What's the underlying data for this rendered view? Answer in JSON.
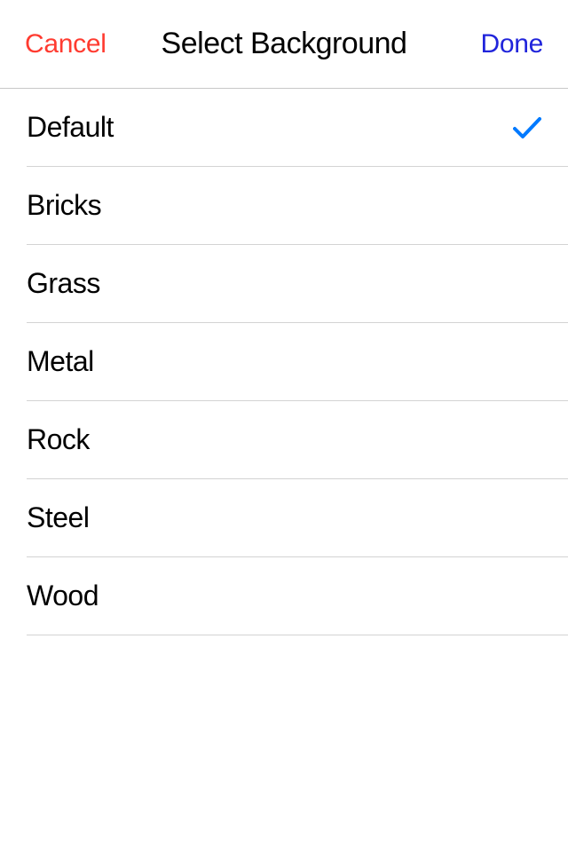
{
  "navbar": {
    "cancel_label": "Cancel",
    "title": "Select Background",
    "done_label": "Done"
  },
  "list": {
    "items": [
      {
        "label": "Default",
        "selected": true
      },
      {
        "label": "Bricks",
        "selected": false
      },
      {
        "label": "Grass",
        "selected": false
      },
      {
        "label": "Metal",
        "selected": false
      },
      {
        "label": "Rock",
        "selected": false
      },
      {
        "label": "Steel",
        "selected": false
      },
      {
        "label": "Wood",
        "selected": false
      }
    ]
  }
}
